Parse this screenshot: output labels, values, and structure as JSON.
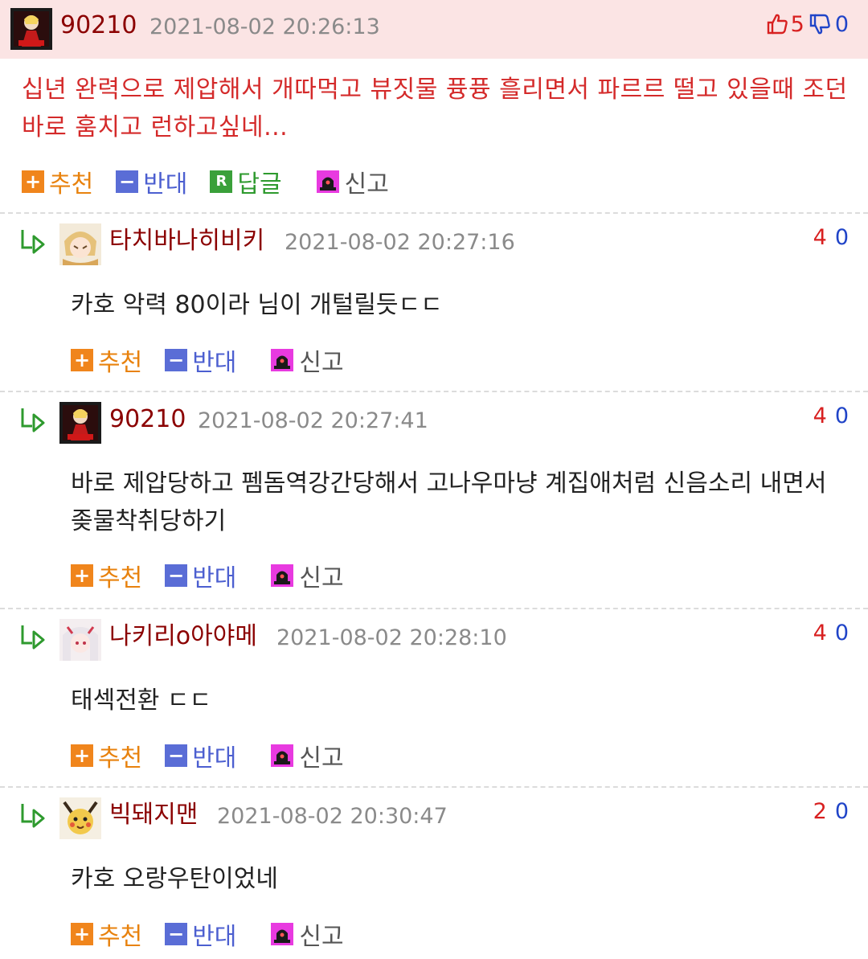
{
  "top_comment": {
    "nickname": "90210",
    "date": "2021-08-02 20:26:13",
    "up_count": "5",
    "down_count": "0",
    "body": "십년 완력으로 제압해서 개따먹고 뷰짓물 퓽퓽 흘리면서 파르르 떨고 있을때 조던 바로 훔치고 런하고싶네...",
    "actions": {
      "recommend": "추천",
      "oppose": "반대",
      "reply": "답글",
      "report": "신고"
    }
  },
  "replies": [
    {
      "nickname": "타치바나히비키",
      "date": "2021-08-02 20:27:16",
      "up": "4",
      "down": "0",
      "body": "카호 악력 80이라 님이 개털릴듯ㄷㄷ",
      "actions": {
        "recommend": "추천",
        "oppose": "반대",
        "report": "신고"
      }
    },
    {
      "nickname": "90210",
      "date": "2021-08-02 20:27:41",
      "up": "4",
      "down": "0",
      "body": "바로 제압당하고 펨돔역강간당해서 고나우마냥 계집애처럼 신음소리 내면서 좆물착취당하기",
      "actions": {
        "recommend": "추천",
        "oppose": "반대",
        "report": "신고"
      }
    },
    {
      "nickname": "나키리o아야메",
      "date": "2021-08-02 20:28:10",
      "up": "4",
      "down": "0",
      "body": "태섹전환 ㄷㄷ",
      "actions": {
        "recommend": "추천",
        "oppose": "반대",
        "report": "신고"
      }
    },
    {
      "nickname": "빅돼지맨",
      "date": "2021-08-02 20:30:47",
      "up": "2",
      "down": "0",
      "body": "카호 오랑우탄이었네",
      "actions": {
        "recommend": "추천",
        "oppose": "반대",
        "report": "신고"
      }
    }
  ],
  "icons": {
    "recommend": "plus-icon",
    "oppose": "minus-icon",
    "reply": "reply-r-icon",
    "report": "siren-icon",
    "thumbs_up": "thumbs-up-icon",
    "thumbs_down": "thumbs-down-icon",
    "reply_indent": "reply-arrow-icon"
  },
  "colors": {
    "header_bg": "#fbe4e4",
    "nickname": "#8b0000",
    "top_body_text": "#d42a2a",
    "up": "#d82020",
    "down": "#2044c8",
    "recommend": "#f0851c",
    "oppose": "#5a6dd6",
    "reply": "#3aa03a"
  }
}
